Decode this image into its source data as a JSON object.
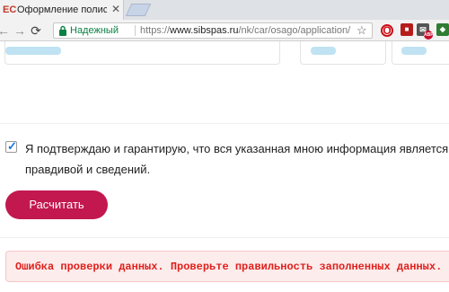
{
  "browser": {
    "tab": {
      "title": "Оформление полиса он",
      "favicon_text": "ЕС",
      "close_glyph": "✕"
    },
    "nav": {
      "back_glyph": "←",
      "forward_glyph": "→",
      "reload_glyph": "⟳",
      "home_glyph": "⌂"
    },
    "omnibox": {
      "secure_label": "Надежный",
      "url_scheme": "https://",
      "url_host": "www.sibspas.ru",
      "url_path": "/nk/car/osago/application/",
      "star_glyph": "☆"
    },
    "extensions": {
      "opera_glyph": "O",
      "ext2_glyph": "■",
      "ext3_glyph": "✉",
      "abp_label": "ABP",
      "ext5_glyph": "◆"
    },
    "colors": {
      "secure_green": "#0b8043",
      "opera_red": "#cc0f16",
      "abp_red": "#c70d2c"
    }
  },
  "page": {
    "confirm_text": "Я подтверждаю и гарантирую, что вся указанная мною информация является правдивой и сведений.",
    "confirm_checked": true,
    "calculate_label": "Расчитать",
    "error_message": "Ошибка проверки данных. Проверьте правильность заполненных данных.",
    "colors": {
      "button": "#c2184f",
      "error_text": "#e0201b",
      "error_bg": "#fdecec",
      "checkbox_accent": "#1a73e8"
    }
  }
}
